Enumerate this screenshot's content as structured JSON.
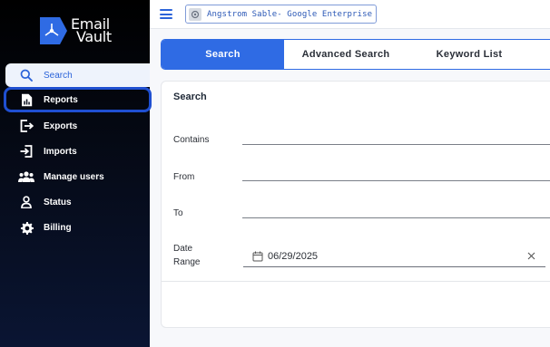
{
  "app": {
    "logo_line1": "Email",
    "logo_line2": "Vault"
  },
  "sidebar": {
    "items": [
      {
        "label": "Search",
        "icon": "search-icon"
      },
      {
        "label": "Reports",
        "icon": "report-icon"
      },
      {
        "label": "Exports",
        "icon": "export-icon"
      },
      {
        "label": "Imports",
        "icon": "import-icon"
      },
      {
        "label": "Manage users",
        "icon": "users-icon"
      },
      {
        "label": "Status",
        "icon": "person-icon"
      },
      {
        "label": "Billing",
        "icon": "gear-icon"
      }
    ],
    "active_item": "Search",
    "focused_item": "Reports"
  },
  "topbar": {
    "org_name": "Angstrom Sable- Google Enterprise",
    "org_icon": "building-icon"
  },
  "tabs": [
    {
      "label": "Search",
      "active": true
    },
    {
      "label": "Advanced Search",
      "active": false
    },
    {
      "label": "Keyword List",
      "active": false
    }
  ],
  "form": {
    "title": "Search",
    "contains_label": "Contains",
    "contains_value": "",
    "from_label": "From",
    "from_value": "",
    "to_label": "To",
    "to_value": "",
    "date_label_line1": "Date",
    "date_label_line2": "Range",
    "date_value": "06/29/2025"
  },
  "colors": {
    "accent": "#2f6be4",
    "sidebar_bg": "#050914",
    "active_nav_bg": "#eef3fc",
    "focus_ring": "#1f4fd1"
  }
}
